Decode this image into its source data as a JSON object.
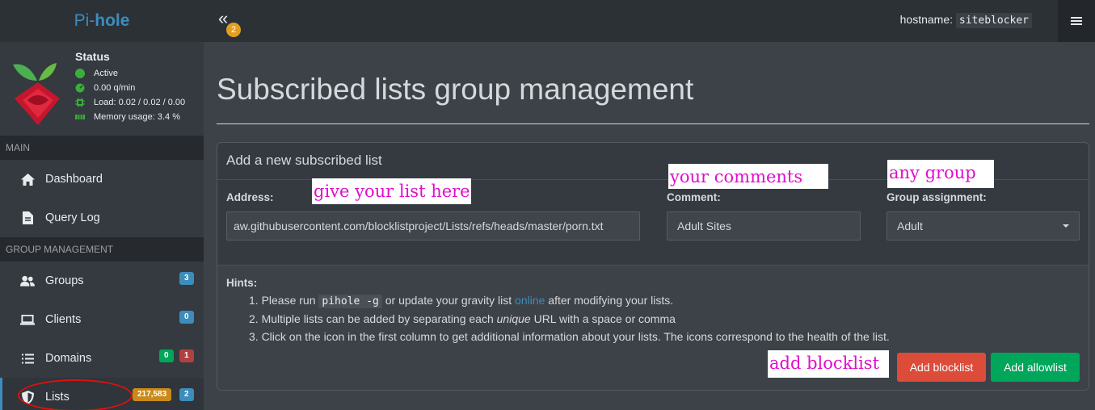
{
  "brand": {
    "prefix": "Pi-",
    "name": "hole"
  },
  "status": {
    "title": "Status",
    "items": [
      {
        "icon": "status-dot-icon",
        "text": "Active"
      },
      {
        "icon": "gauge-icon",
        "text": "0.00 q/min"
      },
      {
        "icon": "cpu-icon",
        "text": "Load: 0.02 / 0.02 / 0.00"
      },
      {
        "icon": "memory-icon",
        "text": "Memory usage: 3.4 %"
      }
    ]
  },
  "sidebar": {
    "main_header": "MAIN",
    "group_header": "GROUP MANAGEMENT",
    "items": [
      {
        "label": "Dashboard",
        "icon": "home-icon"
      },
      {
        "label": "Query Log",
        "icon": "file-icon"
      },
      {
        "label": "Groups",
        "icon": "users-icon",
        "badge": "3"
      },
      {
        "label": "Clients",
        "icon": "laptop-icon",
        "badge": "0"
      },
      {
        "label": "Domains",
        "icon": "list-icon",
        "badge1": "0",
        "badge2": "1"
      },
      {
        "label": "Lists",
        "icon": "shield-icon",
        "badge1": "217,583",
        "badge2": "2"
      }
    ]
  },
  "topbar": {
    "collapse_icon": "«",
    "notification_count": "2",
    "hostname_label": "hostname:",
    "hostname_value": "siteblocker"
  },
  "page": {
    "title": "Subscribed lists group management"
  },
  "form": {
    "box_title": "Add a new subscribed list",
    "address_label": "Address:",
    "address_value": "aw.githubusercontent.com/blocklistproject/Lists/refs/heads/master/porn.txt",
    "comment_label": "Comment:",
    "comment_value": "Adult Sites",
    "group_label": "Group assignment:",
    "group_value": "Adult"
  },
  "hints": {
    "title": "Hints:",
    "h1_pre": "1. Please run",
    "h1_code": "pihole -g",
    "h1_mid": "or update your gravity list",
    "h1_link": "online",
    "h1_post": "after modifying your lists.",
    "h2_pre": "2. Multiple lists can be added by separating each",
    "h2_em": "unique",
    "h2_post": "URL with a space or comma",
    "h3": "3. Click on the icon in the first column to get additional information about your lists. The icons correspond to the health of the list."
  },
  "buttons": {
    "add_blocklist": "Add blocklist",
    "add_allowlist": "Add allowlist"
  },
  "annotations": {
    "address": "give your list here",
    "comment": "your comments",
    "group": "any group",
    "blocklist": "add blocklist"
  },
  "colors": {
    "accent": "#3c8dbc",
    "danger": "#dd4b39",
    "success": "#00a65a",
    "annotation": "#e00ecc",
    "highlight_ellipse": "#e01010"
  }
}
